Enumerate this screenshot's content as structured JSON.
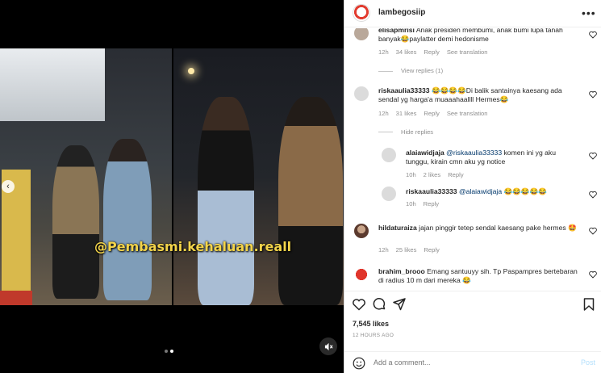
{
  "post": {
    "username": "lambegosiip",
    "watermark": "@Pembasmi.kehaluan.reall",
    "likes": "7,545 likes",
    "time_ago": "12 HOURS AGO"
  },
  "comment_box": {
    "placeholder": "Add a comment...",
    "post_label": "Post"
  },
  "comments": [
    {
      "user": "elisapmrisi",
      "text": "Anak presiden membumi, anak bumi lupa tanah banyak😂paylatter demi hedonisme",
      "time": "12h",
      "likes": "34 likes",
      "reply": "Reply",
      "translate": "See translation",
      "view_replies": "View replies (1)"
    },
    {
      "user": "riskaaulia33333",
      "text": "😂😂😂😂Di balik santainya kaesang ada sendal yg harga'a muaaahaallll Hermes😂",
      "time": "12h",
      "likes": "31 likes",
      "reply": "Reply",
      "translate": "See translation",
      "hide_replies": "Hide replies"
    },
    {
      "user": "alaiawidjaja",
      "mention": "@riskaaulia33333",
      "text": " komen ini yg aku tunggu, kirain cmn aku yg notice",
      "time": "10h",
      "likes": "2 likes",
      "reply": "Reply"
    },
    {
      "user": "riskaaulia33333",
      "mention": "@alaiawidjaja",
      "text": " 😂😂😂😂😂",
      "time": "10h",
      "reply": "Reply"
    },
    {
      "user": "hildaturaiza",
      "text": "jajan pinggir tetep sendal kaesang pake hermes 🤩",
      "time": "12h",
      "likes": "25 likes",
      "reply": "Reply"
    },
    {
      "user": "brahim_brooo",
      "text": "Emang santuuyy sih. Tp Paspampres bertebaran di radius 10 m dari mereka 😂"
    }
  ],
  "colors": {
    "link": "#00376b",
    "muted": "#8e8e8e",
    "watermark": "#f3d44a",
    "post_btn": "#b2dffc"
  },
  "icons": [
    "more-icon",
    "heart-icon",
    "comment-icon",
    "share-icon",
    "bookmark-icon",
    "emoji-icon",
    "mute-icon",
    "chevron-left-icon"
  ]
}
